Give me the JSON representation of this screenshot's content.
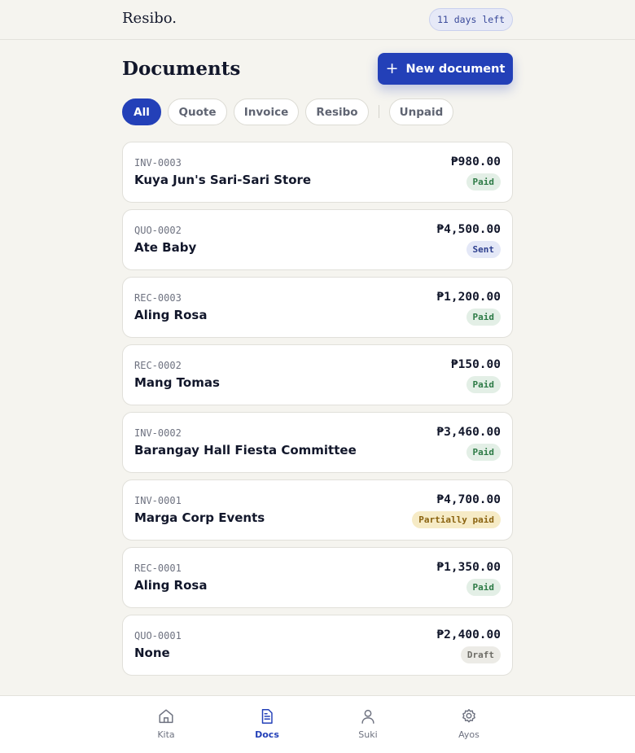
{
  "header": {
    "brand": "Resibo.",
    "trial_badge": "11 days left"
  },
  "main": {
    "title": "Documents",
    "new_button": {
      "icon": "plus-icon",
      "label": "New document"
    }
  },
  "filters": [
    {
      "label": "All",
      "active": true
    },
    {
      "label": "Quote",
      "active": false
    },
    {
      "label": "Invoice",
      "active": false
    },
    {
      "label": "Resibo",
      "active": false
    },
    {
      "label": "Unpaid",
      "active": false
    }
  ],
  "documents": [
    {
      "number": "INV-0003",
      "client": "Kuya Jun's Sari-Sari Store",
      "amount": "₱980.00",
      "status": "Paid"
    },
    {
      "number": "QUO-0002",
      "client": "Ate Baby",
      "amount": "₱4,500.00",
      "status": "Sent"
    },
    {
      "number": "REC-0003",
      "client": "Aling Rosa",
      "amount": "₱1,200.00",
      "status": "Paid"
    },
    {
      "number": "REC-0002",
      "client": "Mang Tomas",
      "amount": "₱150.00",
      "status": "Paid"
    },
    {
      "number": "INV-0002",
      "client": "Barangay Hall Fiesta Committee",
      "amount": "₱3,460.00",
      "status": "Paid"
    },
    {
      "number": "INV-0001",
      "client": "Marga Corp Events",
      "amount": "₱4,700.00",
      "status": "Partially paid"
    },
    {
      "number": "REC-0001",
      "client": "Aling Rosa",
      "amount": "₱1,350.00",
      "status": "Paid"
    },
    {
      "number": "QUO-0001",
      "client": "None",
      "amount": "₱2,400.00",
      "status": "Draft"
    }
  ],
  "status_colors": {
    "Paid": "#2c7a45",
    "Sent": "#2d3f8e",
    "Partially paid": "#8a6310",
    "Draft": "#6d6c66"
  },
  "accent_color": "#2340b8",
  "bottom_nav": [
    {
      "label": "Kita",
      "icon": "home-icon",
      "active": false
    },
    {
      "label": "Docs",
      "icon": "document-icon",
      "active": true
    },
    {
      "label": "Suki",
      "icon": "person-icon",
      "active": false
    },
    {
      "label": "Ayos",
      "icon": "gear-icon",
      "active": false
    }
  ]
}
